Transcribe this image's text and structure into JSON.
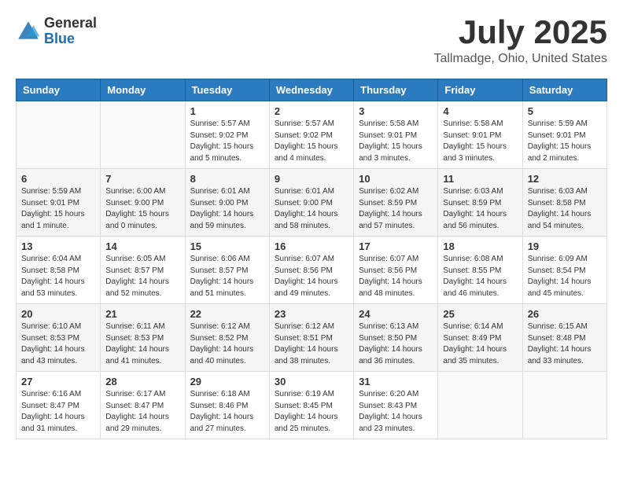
{
  "header": {
    "logo_general": "General",
    "logo_blue": "Blue",
    "main_title": "July 2025",
    "sub_title": "Tallmadge, Ohio, United States"
  },
  "days_of_week": [
    "Sunday",
    "Monday",
    "Tuesday",
    "Wednesday",
    "Thursday",
    "Friday",
    "Saturday"
  ],
  "weeks": [
    [
      {
        "day": "",
        "info": ""
      },
      {
        "day": "",
        "info": ""
      },
      {
        "day": "1",
        "info": "Sunrise: 5:57 AM\nSunset: 9:02 PM\nDaylight: 15 hours and 5 minutes."
      },
      {
        "day": "2",
        "info": "Sunrise: 5:57 AM\nSunset: 9:02 PM\nDaylight: 15 hours and 4 minutes."
      },
      {
        "day": "3",
        "info": "Sunrise: 5:58 AM\nSunset: 9:01 PM\nDaylight: 15 hours and 3 minutes."
      },
      {
        "day": "4",
        "info": "Sunrise: 5:58 AM\nSunset: 9:01 PM\nDaylight: 15 hours and 3 minutes."
      },
      {
        "day": "5",
        "info": "Sunrise: 5:59 AM\nSunset: 9:01 PM\nDaylight: 15 hours and 2 minutes."
      }
    ],
    [
      {
        "day": "6",
        "info": "Sunrise: 5:59 AM\nSunset: 9:01 PM\nDaylight: 15 hours and 1 minute."
      },
      {
        "day": "7",
        "info": "Sunrise: 6:00 AM\nSunset: 9:00 PM\nDaylight: 15 hours and 0 minutes."
      },
      {
        "day": "8",
        "info": "Sunrise: 6:01 AM\nSunset: 9:00 PM\nDaylight: 14 hours and 59 minutes."
      },
      {
        "day": "9",
        "info": "Sunrise: 6:01 AM\nSunset: 9:00 PM\nDaylight: 14 hours and 58 minutes."
      },
      {
        "day": "10",
        "info": "Sunrise: 6:02 AM\nSunset: 8:59 PM\nDaylight: 14 hours and 57 minutes."
      },
      {
        "day": "11",
        "info": "Sunrise: 6:03 AM\nSunset: 8:59 PM\nDaylight: 14 hours and 56 minutes."
      },
      {
        "day": "12",
        "info": "Sunrise: 6:03 AM\nSunset: 8:58 PM\nDaylight: 14 hours and 54 minutes."
      }
    ],
    [
      {
        "day": "13",
        "info": "Sunrise: 6:04 AM\nSunset: 8:58 PM\nDaylight: 14 hours and 53 minutes."
      },
      {
        "day": "14",
        "info": "Sunrise: 6:05 AM\nSunset: 8:57 PM\nDaylight: 14 hours and 52 minutes."
      },
      {
        "day": "15",
        "info": "Sunrise: 6:06 AM\nSunset: 8:57 PM\nDaylight: 14 hours and 51 minutes."
      },
      {
        "day": "16",
        "info": "Sunrise: 6:07 AM\nSunset: 8:56 PM\nDaylight: 14 hours and 49 minutes."
      },
      {
        "day": "17",
        "info": "Sunrise: 6:07 AM\nSunset: 8:56 PM\nDaylight: 14 hours and 48 minutes."
      },
      {
        "day": "18",
        "info": "Sunrise: 6:08 AM\nSunset: 8:55 PM\nDaylight: 14 hours and 46 minutes."
      },
      {
        "day": "19",
        "info": "Sunrise: 6:09 AM\nSunset: 8:54 PM\nDaylight: 14 hours and 45 minutes."
      }
    ],
    [
      {
        "day": "20",
        "info": "Sunrise: 6:10 AM\nSunset: 8:53 PM\nDaylight: 14 hours and 43 minutes."
      },
      {
        "day": "21",
        "info": "Sunrise: 6:11 AM\nSunset: 8:53 PM\nDaylight: 14 hours and 41 minutes."
      },
      {
        "day": "22",
        "info": "Sunrise: 6:12 AM\nSunset: 8:52 PM\nDaylight: 14 hours and 40 minutes."
      },
      {
        "day": "23",
        "info": "Sunrise: 6:12 AM\nSunset: 8:51 PM\nDaylight: 14 hours and 38 minutes."
      },
      {
        "day": "24",
        "info": "Sunrise: 6:13 AM\nSunset: 8:50 PM\nDaylight: 14 hours and 36 minutes."
      },
      {
        "day": "25",
        "info": "Sunrise: 6:14 AM\nSunset: 8:49 PM\nDaylight: 14 hours and 35 minutes."
      },
      {
        "day": "26",
        "info": "Sunrise: 6:15 AM\nSunset: 8:48 PM\nDaylight: 14 hours and 33 minutes."
      }
    ],
    [
      {
        "day": "27",
        "info": "Sunrise: 6:16 AM\nSunset: 8:47 PM\nDaylight: 14 hours and 31 minutes."
      },
      {
        "day": "28",
        "info": "Sunrise: 6:17 AM\nSunset: 8:47 PM\nDaylight: 14 hours and 29 minutes."
      },
      {
        "day": "29",
        "info": "Sunrise: 6:18 AM\nSunset: 8:46 PM\nDaylight: 14 hours and 27 minutes."
      },
      {
        "day": "30",
        "info": "Sunrise: 6:19 AM\nSunset: 8:45 PM\nDaylight: 14 hours and 25 minutes."
      },
      {
        "day": "31",
        "info": "Sunrise: 6:20 AM\nSunset: 8:43 PM\nDaylight: 14 hours and 23 minutes."
      },
      {
        "day": "",
        "info": ""
      },
      {
        "day": "",
        "info": ""
      }
    ]
  ]
}
